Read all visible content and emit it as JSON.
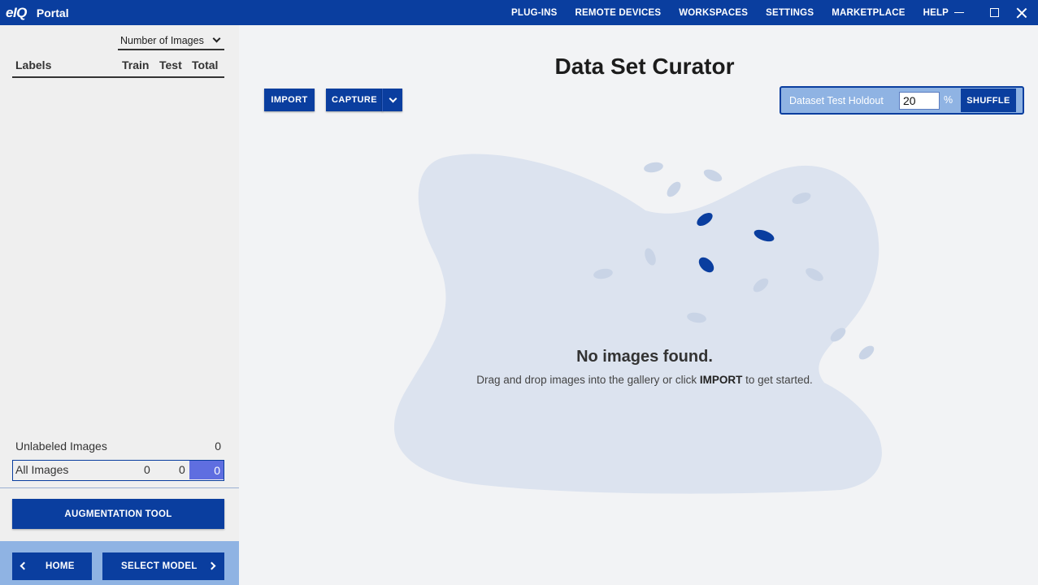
{
  "titlebar": {
    "logo": "eIQ",
    "app_name": "Portal",
    "nav": [
      "PLUG-INS",
      "REMOTE DEVICES",
      "WORKSPACES",
      "SETTINGS",
      "MARKETPLACE",
      "HELP"
    ]
  },
  "sidebar": {
    "sort_select": "Number of Images",
    "columns": {
      "labels": "Labels",
      "train": "Train",
      "test": "Test",
      "total": "Total"
    },
    "unlabeled": {
      "label": "Unlabeled Images",
      "total": "0"
    },
    "all_images": {
      "label": "All Images",
      "train": "0",
      "test": "0",
      "total": "0"
    },
    "augmentation_label": "AUGMENTATION TOOL",
    "home_label": "HOME",
    "select_model_label": "SELECT MODEL"
  },
  "main": {
    "title": "Data Set Curator",
    "import_label": "IMPORT",
    "capture_label": "CAPTURE",
    "holdout": {
      "label": "Dataset Test Holdout",
      "value": "20",
      "unit": "%",
      "shuffle_label": "SHUFFLE"
    },
    "empty": {
      "title": "No images found.",
      "hint_before": "Drag and drop images into the gallery or click ",
      "hint_emphasis": "IMPORT",
      "hint_after": " to get started."
    }
  },
  "colors": {
    "primary": "#0a3e9f",
    "accent_light": "#8fb3e3",
    "highlight": "#5f6ee0",
    "blob": "#dce3ef",
    "leaf_light": "#c9d4e6"
  }
}
